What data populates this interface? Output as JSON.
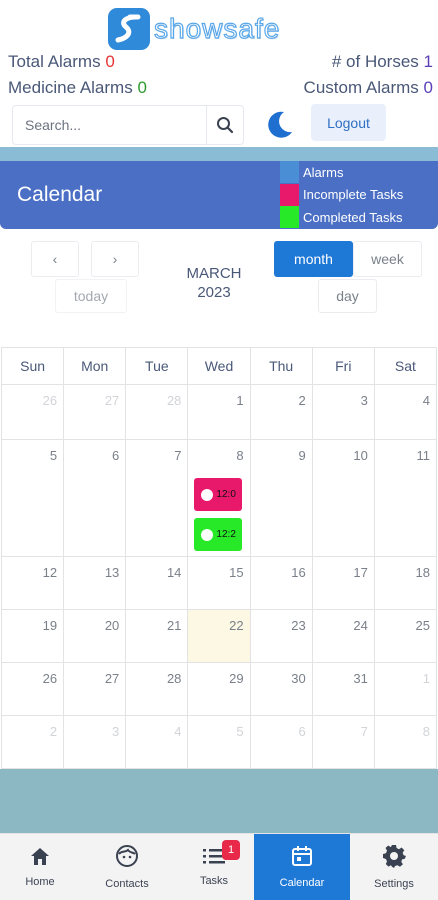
{
  "app": {
    "brand": "showsafe",
    "colors": {
      "accent": "#1e78d6",
      "header": "#4a6fc4",
      "band": "#8bbcd6"
    }
  },
  "stats": {
    "total_alarms_label": "Total Alarms",
    "total_alarms_value": "0",
    "horses_label": "# of Horses",
    "horses_value": "1",
    "medicine_label": "Medicine Alarms",
    "medicine_value": "0",
    "custom_label": "Custom Alarms",
    "custom_value": "0"
  },
  "search": {
    "placeholder": "Search...",
    "value": ""
  },
  "logout_label": "Logout",
  "calendar": {
    "title": "Calendar",
    "legend": [
      {
        "label": "Alarms",
        "color": "#4a8fd6"
      },
      {
        "label": "Incomplete Tasks",
        "color": "#e8196b"
      },
      {
        "label": "Completed Tasks",
        "color": "#27e927"
      }
    ],
    "toolbar": {
      "prev": "‹",
      "next": "›",
      "today": "today",
      "month": "month",
      "week": "week",
      "day": "day"
    },
    "month_label": "MARCH",
    "year_label": "2023",
    "days_of_week": [
      "Sun",
      "Mon",
      "Tue",
      "Wed",
      "Thu",
      "Fri",
      "Sat"
    ],
    "weeks": [
      [
        "26",
        "27",
        "28",
        "1",
        "2",
        "3",
        "4"
      ],
      [
        "5",
        "6",
        "7",
        "8",
        "9",
        "10",
        "11"
      ],
      [
        "12",
        "13",
        "14",
        "15",
        "16",
        "17",
        "18"
      ],
      [
        "19",
        "20",
        "21",
        "22",
        "23",
        "24",
        "25"
      ],
      [
        "26",
        "27",
        "28",
        "29",
        "30",
        "31",
        "1"
      ],
      [
        "2",
        "3",
        "4",
        "5",
        "6",
        "7",
        "8"
      ]
    ],
    "today": "22",
    "events": [
      {
        "day": "8",
        "time": "12:0",
        "status": "incomplete",
        "color": "#e8196b"
      },
      {
        "day": "8",
        "time": "12:2",
        "status": "completed",
        "color": "#27e927"
      }
    ]
  },
  "nav": [
    {
      "label": "Home",
      "icon": "home-icon"
    },
    {
      "label": "Contacts",
      "icon": "face-icon"
    },
    {
      "label": "Tasks",
      "icon": "list-icon",
      "badge": "1"
    },
    {
      "label": "Calendar",
      "icon": "calendar-icon",
      "active": true
    },
    {
      "label": "Settings",
      "icon": "gear-icon"
    }
  ]
}
